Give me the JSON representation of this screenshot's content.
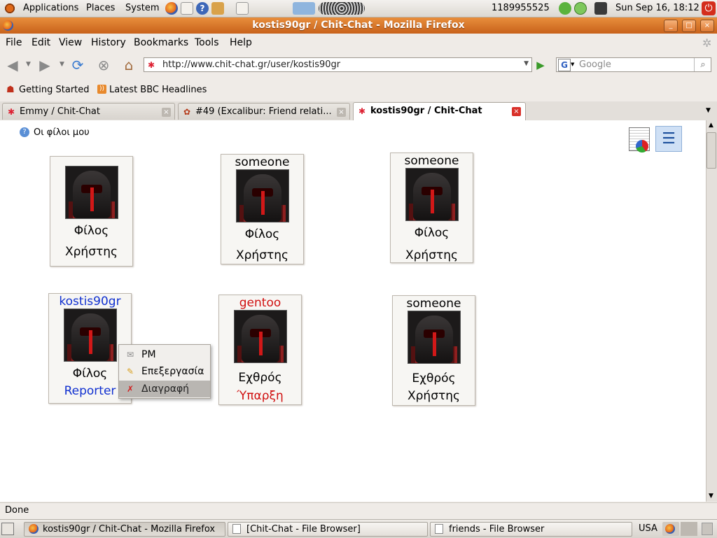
{
  "top_panel": {
    "menus": [
      "Applications",
      "Places",
      "System"
    ],
    "battery_text": "1189955525",
    "clock": "Sun Sep 16, 18:12"
  },
  "window": {
    "title": "kostis90gr / Chit-Chat - Mozilla Firefox",
    "buttons": [
      "_",
      "□",
      "×"
    ]
  },
  "menubar": [
    "File",
    "Edit",
    "View",
    "History",
    "Bookmarks",
    "Tools",
    "Help"
  ],
  "navbar": {
    "url": "http://www.chit-chat.gr/user/kostis90gr",
    "search_placeholder": "Google"
  },
  "bookmarks": [
    "Getting Started",
    "Latest BBC Headlines"
  ],
  "tabs": [
    {
      "label": "Emmy / Chit-Chat"
    },
    {
      "label": "#49 (Excalibur: Friend relati..."
    },
    {
      "label": "kostis90gr / Chit-Chat"
    }
  ],
  "page": {
    "section_title": "Οι φίλοι μου",
    "cards": [
      {
        "name": "",
        "name_color": "#000000",
        "line1": "Φίλος",
        "line1_color": "#000000",
        "line2": "Χρήστης",
        "line2_color": "#000000"
      },
      {
        "name": "someone",
        "name_color": "#000000",
        "line1": "Φίλος",
        "line1_color": "#000000",
        "line2": "Χρήστης",
        "line2_color": "#000000"
      },
      {
        "name": "someone",
        "name_color": "#000000",
        "line1": "Φίλος",
        "line1_color": "#000000",
        "line2": "Χρήστης",
        "line2_color": "#000000"
      },
      {
        "name": "kostis90gr",
        "name_color": "#1030d0",
        "line1": "Φίλος",
        "line1_color": "#000000",
        "line2": "Reporter",
        "line2_color": "#1030d0"
      },
      {
        "name": "gentoo",
        "name_color": "#d01010",
        "line1": "Εχθρός",
        "line1_color": "#000000",
        "line2": "Ύπαρξη",
        "line2_color": "#d01010"
      },
      {
        "name": "someone",
        "name_color": "#000000",
        "line1": "Εχθρός",
        "line1_color": "#000000",
        "line2": "Χρήστης",
        "line2_color": "#000000"
      }
    ],
    "context_menu": [
      {
        "label": "PM",
        "icon": "envelope-icon"
      },
      {
        "label": "Επεξεργασία",
        "icon": "pencil-icon"
      },
      {
        "label": "Διαγραφή",
        "icon": "delete-icon"
      }
    ]
  },
  "status": "Done",
  "taskbar": {
    "tasks": [
      {
        "label": "kostis90gr / Chit-Chat - Mozilla Firefox"
      },
      {
        "label": "[Chit-Chat - File Browser]"
      },
      {
        "label": "friends - File Browser"
      }
    ],
    "keyboard_layout": "USA"
  }
}
